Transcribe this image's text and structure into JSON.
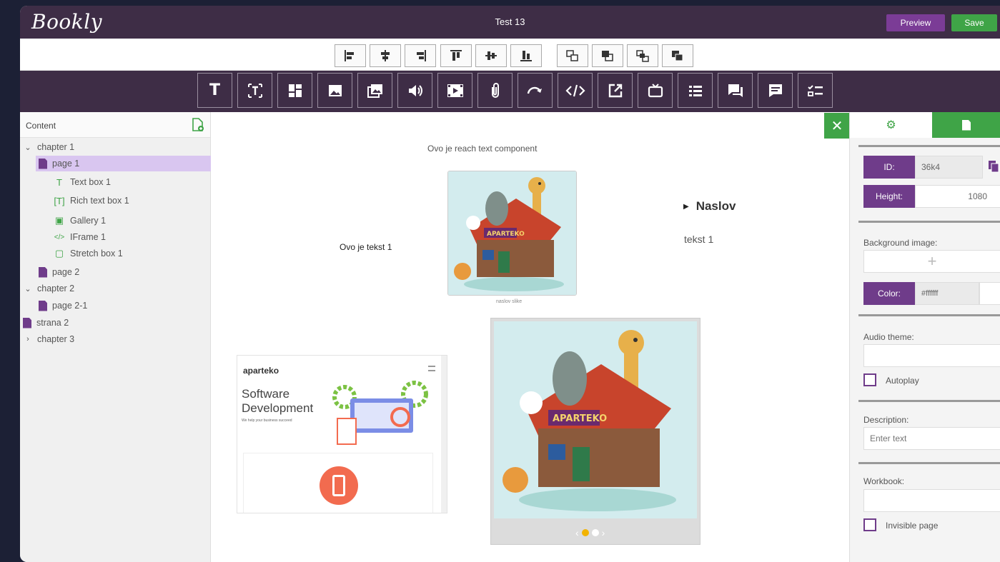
{
  "app": {
    "logo": "Bookly",
    "document_title": "Test 13",
    "preview_label": "Preview",
    "save_label": "Save"
  },
  "align_toolbar": {
    "buttons": [
      "align-left",
      "align-center-horizontal",
      "align-right",
      "align-top",
      "align-middle",
      "align-bottom",
      "bring-forward",
      "send-backward",
      "bring-to-front",
      "send-to-back"
    ]
  },
  "component_toolbar": {
    "buttons": [
      "text",
      "rich-text",
      "layout",
      "image",
      "gallery",
      "audio",
      "video",
      "attachment",
      "redirect",
      "iframe",
      "external-link",
      "stretch-box",
      "list",
      "dialog",
      "comment",
      "checklist"
    ]
  },
  "sidebar": {
    "title": "Content",
    "tree": [
      {
        "label": "chapter 1",
        "type": "chapter",
        "expanded": true
      },
      {
        "label": "page 1",
        "type": "page",
        "selected": true
      },
      {
        "label": "Text box 1",
        "type": "text-box"
      },
      {
        "label": "Rich text box 1",
        "type": "rich-text-box"
      },
      {
        "label": "Gallery 1",
        "type": "gallery"
      },
      {
        "label": "IFrame 1",
        "type": "iframe"
      },
      {
        "label": "Stretch box 1",
        "type": "stretch-box"
      },
      {
        "label": "page 2",
        "type": "page"
      },
      {
        "label": "chapter 2",
        "type": "chapter",
        "expanded": true
      },
      {
        "label": "page 2-1",
        "type": "page"
      },
      {
        "label": "strana 2",
        "type": "page"
      },
      {
        "label": "chapter 3",
        "type": "chapter",
        "expanded": false
      }
    ]
  },
  "canvas": {
    "rich_text": "Ovo je reach text component",
    "text_box": "Ovo je tekst 1",
    "image_caption": "naslov slike",
    "image_sign": "APARTEKO",
    "accordion_title": "Naslov",
    "accordion_text": "tekst 1",
    "iframe": {
      "brand": "aparteko",
      "heading_line1": "Software",
      "heading_line2": "Development",
      "subtext": "We help your business succeed"
    },
    "gallery_dots": 2,
    "gallery_active_dot": 0
  },
  "properties": {
    "id_label": "ID:",
    "id_value": "36k4",
    "height_label": "Height:",
    "height_value": "1080",
    "background_image_label": "Background image:",
    "color_label": "Color:",
    "color_value": "#ffffff",
    "audio_theme_label": "Audio theme:",
    "autoplay_label": "Autoplay",
    "description_label": "Description:",
    "description_placeholder": "Enter text",
    "workbook_label": "Workbook:",
    "invisible_page_label": "Invisible page"
  },
  "colors": {
    "brand_purple": "#3e2d46",
    "accent_purple": "#6f3c8a",
    "green": "#3fa447",
    "selection": "#d9c6f0"
  }
}
